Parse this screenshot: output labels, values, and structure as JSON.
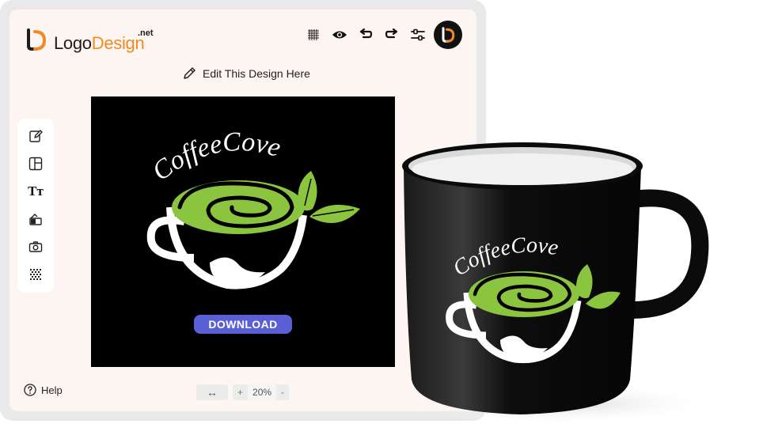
{
  "brand": {
    "name_part1": "Logo",
    "name_part2": "Design",
    "suffix": ".net"
  },
  "toolbar": {
    "items": [
      {
        "name": "grid-icon"
      },
      {
        "name": "eye-icon"
      },
      {
        "name": "undo-icon"
      },
      {
        "name": "redo-icon"
      },
      {
        "name": "settings-sliders-icon"
      }
    ]
  },
  "edit_hint": {
    "label": "Edit This Design Here"
  },
  "side_tools": [
    "pencil-icon",
    "layout-icon",
    "text-icon",
    "shapes-icon",
    "camera-icon",
    "pattern-icon"
  ],
  "side_tools_labels": {
    "text": "Tт"
  },
  "logo_design": {
    "brand_text": "CoffeeCove",
    "leaf_color": "#8bc53f",
    "cup_color": "#ffffff"
  },
  "canvas": {
    "download_label": "DOWNLOAD",
    "background": "#000000"
  },
  "help": {
    "label": "Help"
  },
  "zoom": {
    "arrows": "↔",
    "minus": "-",
    "plus": "+",
    "value": "20%"
  },
  "colors": {
    "accent": "#f08a24",
    "button": "#5b5fd6",
    "panel": "#fdf5f2"
  }
}
